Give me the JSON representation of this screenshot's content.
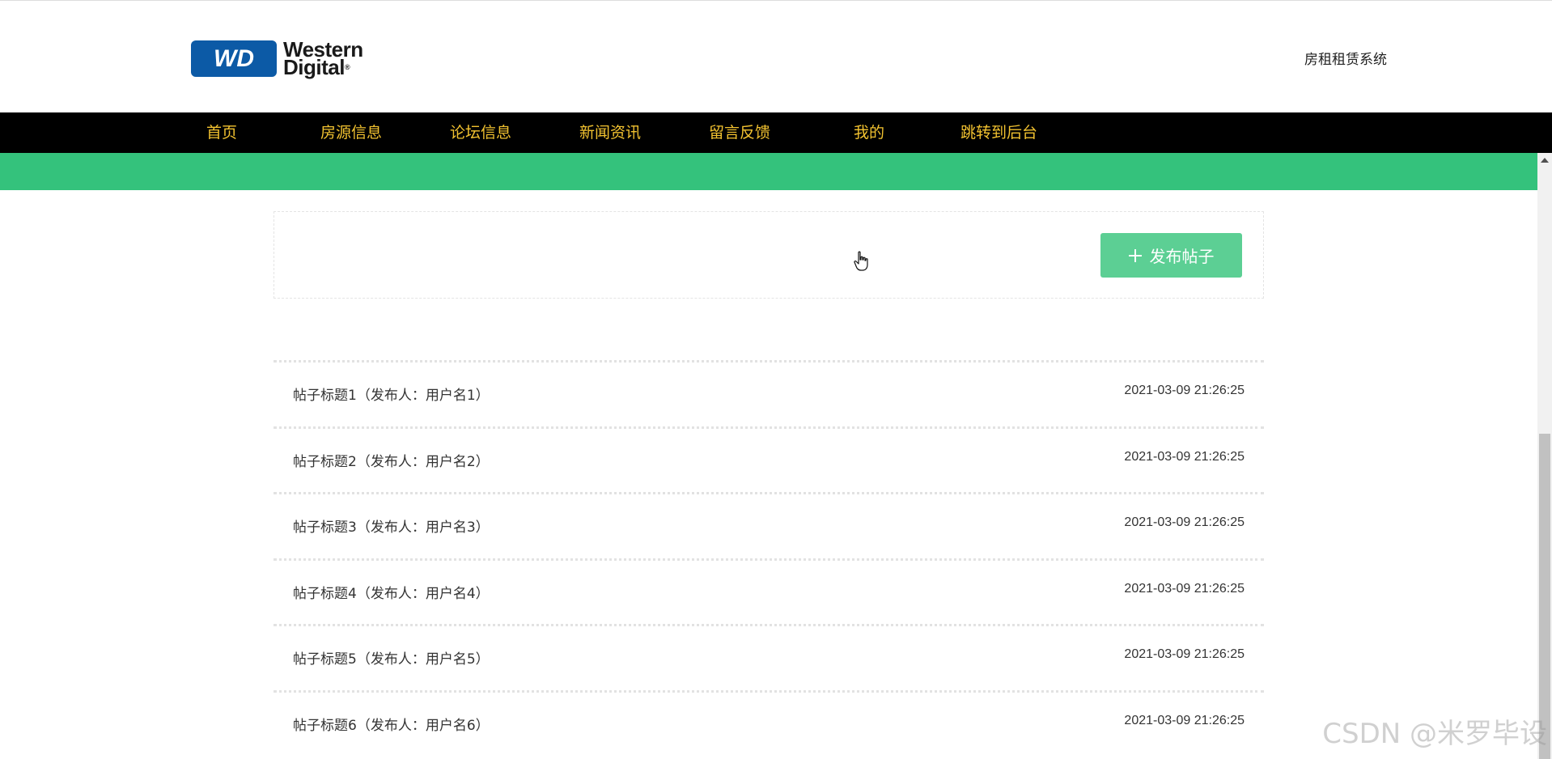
{
  "header": {
    "logo": {
      "line1": "Western",
      "line2": "Digital",
      "badge": "WD",
      "registered": "®",
      "brand_color": "#0c5aa6"
    },
    "system_title": "房租租赁系统"
  },
  "nav": {
    "items": [
      {
        "label": "首页"
      },
      {
        "label": "房源信息"
      },
      {
        "label": "论坛信息"
      },
      {
        "label": "新闻资讯"
      },
      {
        "label": "留言反馈"
      },
      {
        "label": "我的"
      },
      {
        "label": "跳转到后台"
      }
    ],
    "text_color": "#f2c230",
    "background": "#000000"
  },
  "accent_color": "#34c27c",
  "actions": {
    "publish_label": "发布帖子",
    "publish_icon": "plus-icon"
  },
  "posts": [
    {
      "title": "帖子标题1（发布人：用户名1）",
      "time": "2021-03-09 21:26:25"
    },
    {
      "title": "帖子标题2（发布人：用户名2）",
      "time": "2021-03-09 21:26:25"
    },
    {
      "title": "帖子标题3（发布人：用户名3）",
      "time": "2021-03-09 21:26:25"
    },
    {
      "title": "帖子标题4（发布人：用户名4）",
      "time": "2021-03-09 21:26:25"
    },
    {
      "title": "帖子标题5（发布人：用户名5）",
      "time": "2021-03-09 21:26:25"
    },
    {
      "title": "帖子标题6（发布人：用户名6）",
      "time": "2021-03-09 21:26:25"
    }
  ],
  "watermark": "CSDN @米罗毕设"
}
